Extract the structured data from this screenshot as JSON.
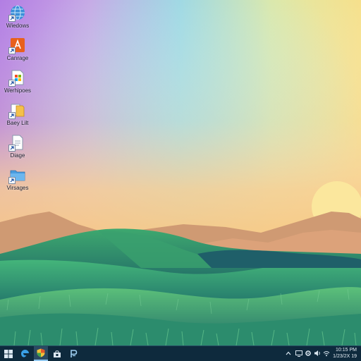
{
  "desktop": {
    "icons": [
      {
        "label": "Wiedows",
        "icon": "globe-icon"
      },
      {
        "label": "Canrage",
        "icon": "orange-app-icon"
      },
      {
        "label": "Werhipoes",
        "icon": "windows-document-icon"
      },
      {
        "label": "Baey Lilt",
        "icon": "folder-document-icon"
      },
      {
        "label": "Diage",
        "icon": "document-icon"
      },
      {
        "label": "Virsages",
        "icon": "blue-folder-icon"
      }
    ]
  },
  "taskbar": {
    "items": [
      {
        "name": "start-button",
        "icon": "windows-logo-icon"
      },
      {
        "name": "edge-taskbar-button",
        "icon": "edge-icon"
      },
      {
        "name": "shield-taskbar-button",
        "icon": "shield-icon"
      },
      {
        "name": "store-taskbar-button",
        "icon": "store-icon"
      },
      {
        "name": "app-p-taskbar-button",
        "icon": "p-app-icon"
      }
    ],
    "tray": [
      "chevron-up-icon",
      "display-icon",
      "settings-icon",
      "speaker-icon",
      "wifi-icon"
    ],
    "clock": {
      "time": "10:15 PM",
      "date": "1/23/2X 19"
    }
  },
  "colors": {
    "taskbar": "#0e2a3d",
    "hill_green": "#2f9a6a",
    "sun": "#fbe59a"
  }
}
